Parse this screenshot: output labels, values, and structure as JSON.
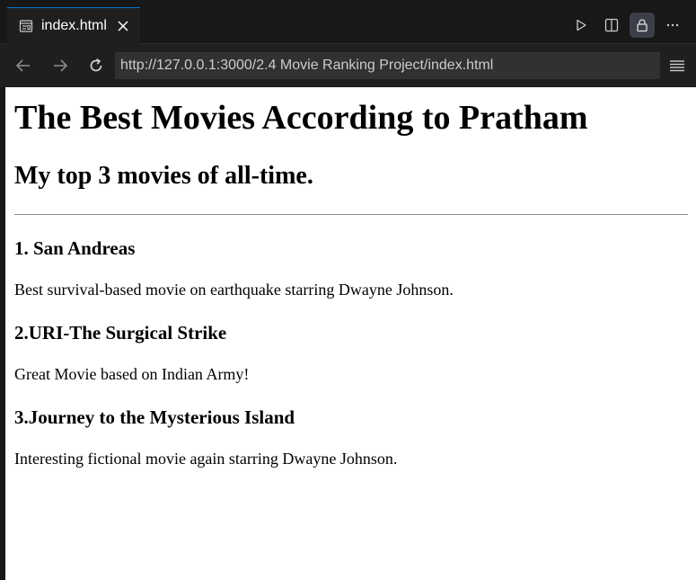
{
  "tab": {
    "title": "index.html"
  },
  "toolbar": {
    "actions": [
      "run-icon",
      "split-editor-icon",
      "lock-icon",
      "more-icon"
    ]
  },
  "navigation": {
    "url": "http://127.0.0.1:3000/2.4 Movie Ranking Project/index.html"
  },
  "page": {
    "title": "The Best Movies According to Pratham",
    "subtitle": "My top 3 movies of all-time.",
    "movies": [
      {
        "heading": "1. San Andreas",
        "description": "Best survival-based movie on earthquake starring Dwayne Johnson."
      },
      {
        "heading": "2.URI-The Surgical Strike",
        "description": "Great Movie based on Indian Army!"
      },
      {
        "heading": "3.Journey to the Mysterious Island",
        "description": "Interesting fictional movie again starring Dwayne Johnson."
      }
    ]
  },
  "colors": {
    "tab_accent": "#0078d4",
    "chrome_bg": "#181818",
    "url_bg": "#313131"
  }
}
